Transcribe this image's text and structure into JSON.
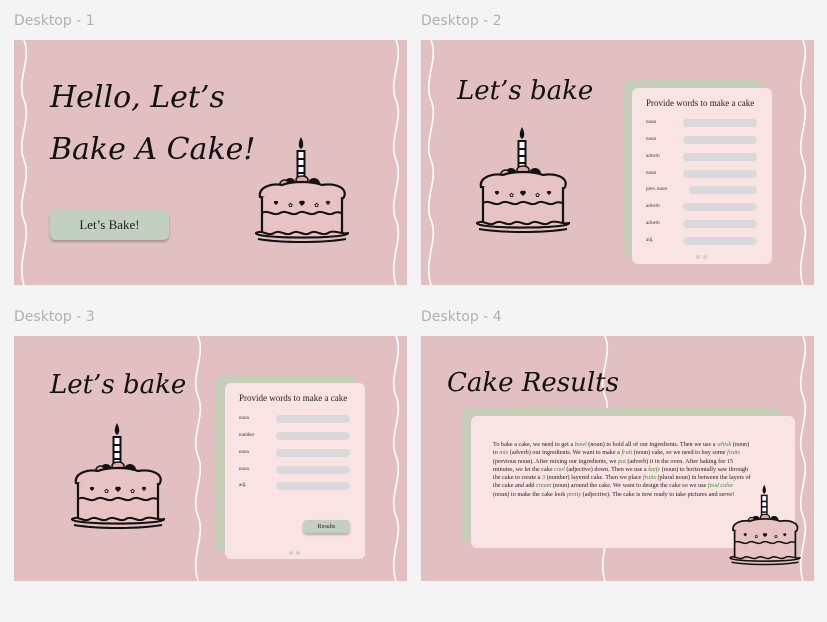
{
  "frames": [
    {
      "label": "Desktop - 1"
    },
    {
      "label": "Desktop - 2"
    },
    {
      "label": "Desktop - 3"
    },
    {
      "label": "Desktop - 4"
    }
  ],
  "d1": {
    "title_line1": "Hello, Let’s",
    "title_line2": "Bake A Cake!",
    "button": "Let’s Bake!"
  },
  "d2": {
    "title": "Let’s bake",
    "form_title": "Provide words to make a cake",
    "fields": [
      "noun",
      "noun",
      "adverb",
      "noun",
      "prev. noun",
      "adverb",
      "adverb",
      "adj."
    ]
  },
  "d3": {
    "title": "Let’s bake",
    "form_title": "Provide words to make a cake",
    "fields": [
      "noun",
      "number",
      "noun",
      "noun",
      "adj."
    ],
    "button": "Results"
  },
  "d4": {
    "title": "Cake Results",
    "story": [
      {
        "t": "To bake a cake, we need to get a "
      },
      {
        "t": "bowl",
        "w": true
      },
      {
        "t": " (noun) to hold all of our ingredients. Then we use a "
      },
      {
        "t": "whisk",
        "w": true
      },
      {
        "t": " (noun) to "
      },
      {
        "t": "mix",
        "w": true
      },
      {
        "t": " (adverb) our ingredients. We want to make a "
      },
      {
        "t": "fruit",
        "w": true
      },
      {
        "t": " (noun) cake, so we need to buy some "
      },
      {
        "t": "fruits",
        "w": true
      },
      {
        "t": " (previous noun). After mixing our ingredients, we "
      },
      {
        "t": "put",
        "w": true
      },
      {
        "t": " (adverb) it in the oven. After baking for 15 minutes, we let the cake "
      },
      {
        "t": "cool",
        "w": true
      },
      {
        "t": " (adjective) down. Then we use a "
      },
      {
        "t": "knife",
        "w": true
      },
      {
        "t": " (noun) to horizontally saw through the cake to create a "
      },
      {
        "t": "3",
        "w": true
      },
      {
        "t": " (number) layered cake. Then we place "
      },
      {
        "t": "fruits",
        "w": true
      },
      {
        "t": " (plural noun) in between the layers of the cake and add "
      },
      {
        "t": "cream",
        "w": true
      },
      {
        "t": " (noun) around the cake. We want to design the cake so we use "
      },
      {
        "t": "food color",
        "w": true
      },
      {
        "t": " (noun) to make the cake look "
      },
      {
        "t": "pretty",
        "w": true
      },
      {
        "t": " (adjective). The cake is now ready to take pictures and serve!"
      }
    ]
  },
  "colors": {
    "artboard": "#e2bfc0",
    "card": "#fae3e3",
    "back_card": "#c6ceba",
    "button": "#c3cfc1",
    "input": "#d9d9d9",
    "story_word": "#3c8a3c"
  }
}
